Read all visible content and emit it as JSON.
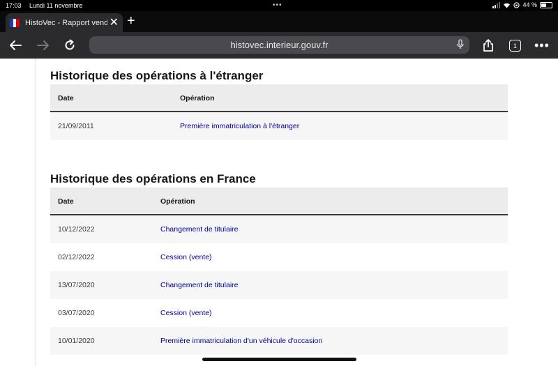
{
  "status_bar": {
    "time": "17:03",
    "date": "Lundi 11 novembre",
    "battery": "44 %"
  },
  "browser": {
    "tab_title": "HistoVec - Rapport vendeur",
    "url": "histovec.interieur.gouv.fr",
    "tab_count": "1",
    "new_tab": "+",
    "close": "✕"
  },
  "etranger": {
    "title": "Historique des opérations à l'étranger",
    "headers": {
      "date": "Date",
      "operation": "Opération"
    },
    "rows": [
      {
        "date": "21/09/2011",
        "operation": "Première immatriculation à l'étranger"
      }
    ]
  },
  "france": {
    "title": "Historique des opérations en France",
    "headers": {
      "date": "Date",
      "operation": "Opération"
    },
    "rows": [
      {
        "date": "10/12/2022",
        "operation": "Changement de titulaire"
      },
      {
        "date": "02/12/2022",
        "operation": "Cession (vente)"
      },
      {
        "date": "13/07/2020",
        "operation": "Changement de titulaire"
      },
      {
        "date": "03/07/2020",
        "operation": "Cession (vente)"
      },
      {
        "date": "10/01/2020",
        "operation": "Première immatriculation d'un véhicule d'occasion"
      }
    ]
  },
  "colors": {
    "link": "#000091",
    "header_bg": "#ececec",
    "row_alt_bg": "#f6f6f6"
  }
}
